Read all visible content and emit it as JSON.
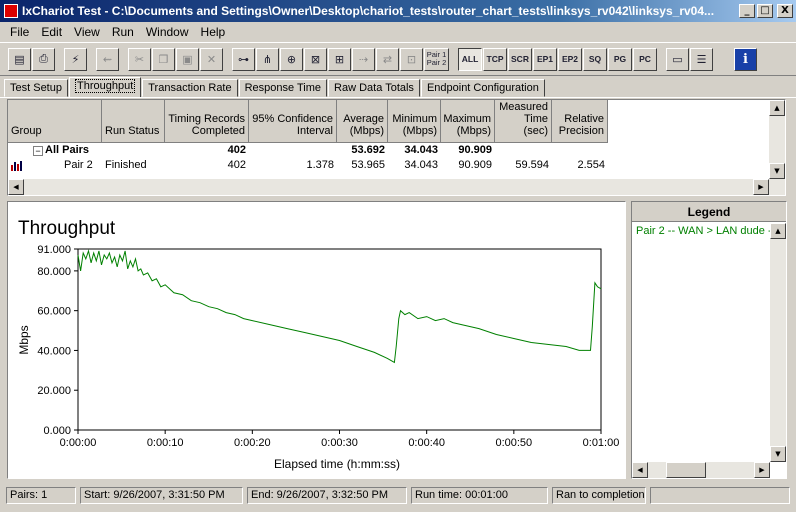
{
  "window": {
    "title": "IxChariot Test - C:\\Documents and Settings\\Owner\\Desktop\\chariot_tests\\router_chart_tests\\linksys_rv042\\linksys_rv04...",
    "min_btn": "_",
    "max_btn": "□",
    "close_btn": "X"
  },
  "menu": [
    "File",
    "Edit",
    "View",
    "Run",
    "Window",
    "Help"
  ],
  "toolbar": {
    "pair_label_1": "Pair 1",
    "pair_label_2": "Pair 2",
    "filters": [
      "ALL",
      "TCP",
      "SCR",
      "EP1",
      "EP2",
      "SQ",
      "PG",
      "PC"
    ],
    "info_label": "i"
  },
  "tabs": [
    "Test Setup",
    "Throughput",
    "Transaction Rate",
    "Response Time",
    "Raw Data Totals",
    "Endpoint Configuration"
  ],
  "grid": {
    "headers": [
      "Group",
      "Run Status",
      "Timing Records Completed",
      "95% Confidence Interval",
      "Average (Mbps)",
      "Minimum (Mbps)",
      "Maximum (Mbps)",
      "Measured Time (sec)",
      "Relative Precision"
    ],
    "all_pairs": {
      "expander": "−",
      "label": "All Pairs",
      "timing_records": "402",
      "average": "53.692",
      "minimum": "34.043",
      "maximum": "90.909"
    },
    "pair": {
      "group": "Pair 2",
      "status": "Finished",
      "timing_records": "402",
      "confidence": "1.378",
      "average": "53.965",
      "minimum": "34.043",
      "maximum": "90.909",
      "measured_time": "59.594",
      "relative_precision": "2.554"
    }
  },
  "chart_data": {
    "type": "line",
    "title": "Throughput",
    "xlabel": "Elapsed time (h:mm:ss)",
    "ylabel": "Mbps",
    "xlim": [
      0,
      60
    ],
    "ylim": [
      0,
      91
    ],
    "y_ticks": [
      "0.000",
      "20.000",
      "40.000",
      "60.000",
      "80.000",
      "91.000"
    ],
    "y_tick_values": [
      0,
      20,
      40,
      60,
      80,
      91
    ],
    "x_ticks": [
      "0:00:00",
      "0:00:10",
      "0:00:20",
      "0:00:30",
      "0:00:40",
      "0:00:50",
      "0:01:00"
    ],
    "x_tick_values": [
      0,
      10,
      20,
      30,
      40,
      50,
      60
    ],
    "grid": false,
    "legend": "right panel",
    "line_color": "#008000",
    "series": [
      {
        "name": "Pair 2 -- WAN > LAN dude -",
        "points": [
          [
            0.0,
            88
          ],
          [
            0.3,
            80
          ],
          [
            0.6,
            89
          ],
          [
            0.9,
            86
          ],
          [
            1.2,
            90
          ],
          [
            1.5,
            84
          ],
          [
            1.8,
            89
          ],
          [
            2.1,
            85
          ],
          [
            2.4,
            90
          ],
          [
            2.7,
            83
          ],
          [
            3.0,
            88
          ],
          [
            3.3,
            86
          ],
          [
            3.6,
            89
          ],
          [
            3.9,
            84
          ],
          [
            4.2,
            87
          ],
          [
            4.5,
            82
          ],
          [
            4.8,
            88
          ],
          [
            5.1,
            85
          ],
          [
            5.4,
            90
          ],
          [
            5.7,
            81
          ],
          [
            6.0,
            85
          ],
          [
            6.3,
            82
          ],
          [
            6.6,
            86
          ],
          [
            6.9,
            80
          ],
          [
            7.2,
            81
          ],
          [
            7.5,
            78
          ],
          [
            8.0,
            79
          ],
          [
            8.5,
            75
          ],
          [
            9.0,
            76
          ],
          [
            9.5,
            72
          ],
          [
            10.0,
            73
          ],
          [
            11.0,
            69
          ],
          [
            12.0,
            68
          ],
          [
            13.0,
            65
          ],
          [
            14.0,
            64
          ],
          [
            15.0,
            62
          ],
          [
            16.0,
            61
          ],
          [
            17.0,
            59
          ],
          [
            18.0,
            58
          ],
          [
            19.0,
            56
          ],
          [
            20.0,
            55
          ],
          [
            22.0,
            53
          ],
          [
            24.0,
            51
          ],
          [
            26.0,
            49
          ],
          [
            28.0,
            47
          ],
          [
            30.0,
            45
          ],
          [
            32.0,
            42
          ],
          [
            34.0,
            39
          ],
          [
            35.5,
            36
          ],
          [
            36.3,
            34
          ],
          [
            36.5,
            42
          ],
          [
            36.8,
            56
          ],
          [
            37.0,
            60
          ],
          [
            37.5,
            58
          ],
          [
            38.0,
            59
          ],
          [
            39.0,
            56
          ],
          [
            40.0,
            57
          ],
          [
            41.0,
            55
          ],
          [
            42.0,
            56
          ],
          [
            43.0,
            54
          ],
          [
            44.0,
            53
          ],
          [
            46.0,
            51
          ],
          [
            48.0,
            48
          ],
          [
            50.0,
            46
          ],
          [
            52.0,
            44
          ],
          [
            54.0,
            43
          ],
          [
            56.0,
            42
          ],
          [
            57.5,
            40
          ],
          [
            58.8,
            40
          ],
          [
            59.0,
            52
          ],
          [
            59.3,
            74
          ],
          [
            59.6,
            72
          ],
          [
            60.0,
            71
          ]
        ]
      }
    ]
  },
  "legend": {
    "title": "Legend",
    "entry": "Pair 2 -- WAN > LAN dude -"
  },
  "status": {
    "pairs": "Pairs: 1",
    "start": "Start: 9/26/2007, 3:31:50 PM",
    "end": "End: 9/26/2007, 3:32:50 PM",
    "run_time": "Run time: 00:01:00",
    "completion": "Ran to completion"
  }
}
